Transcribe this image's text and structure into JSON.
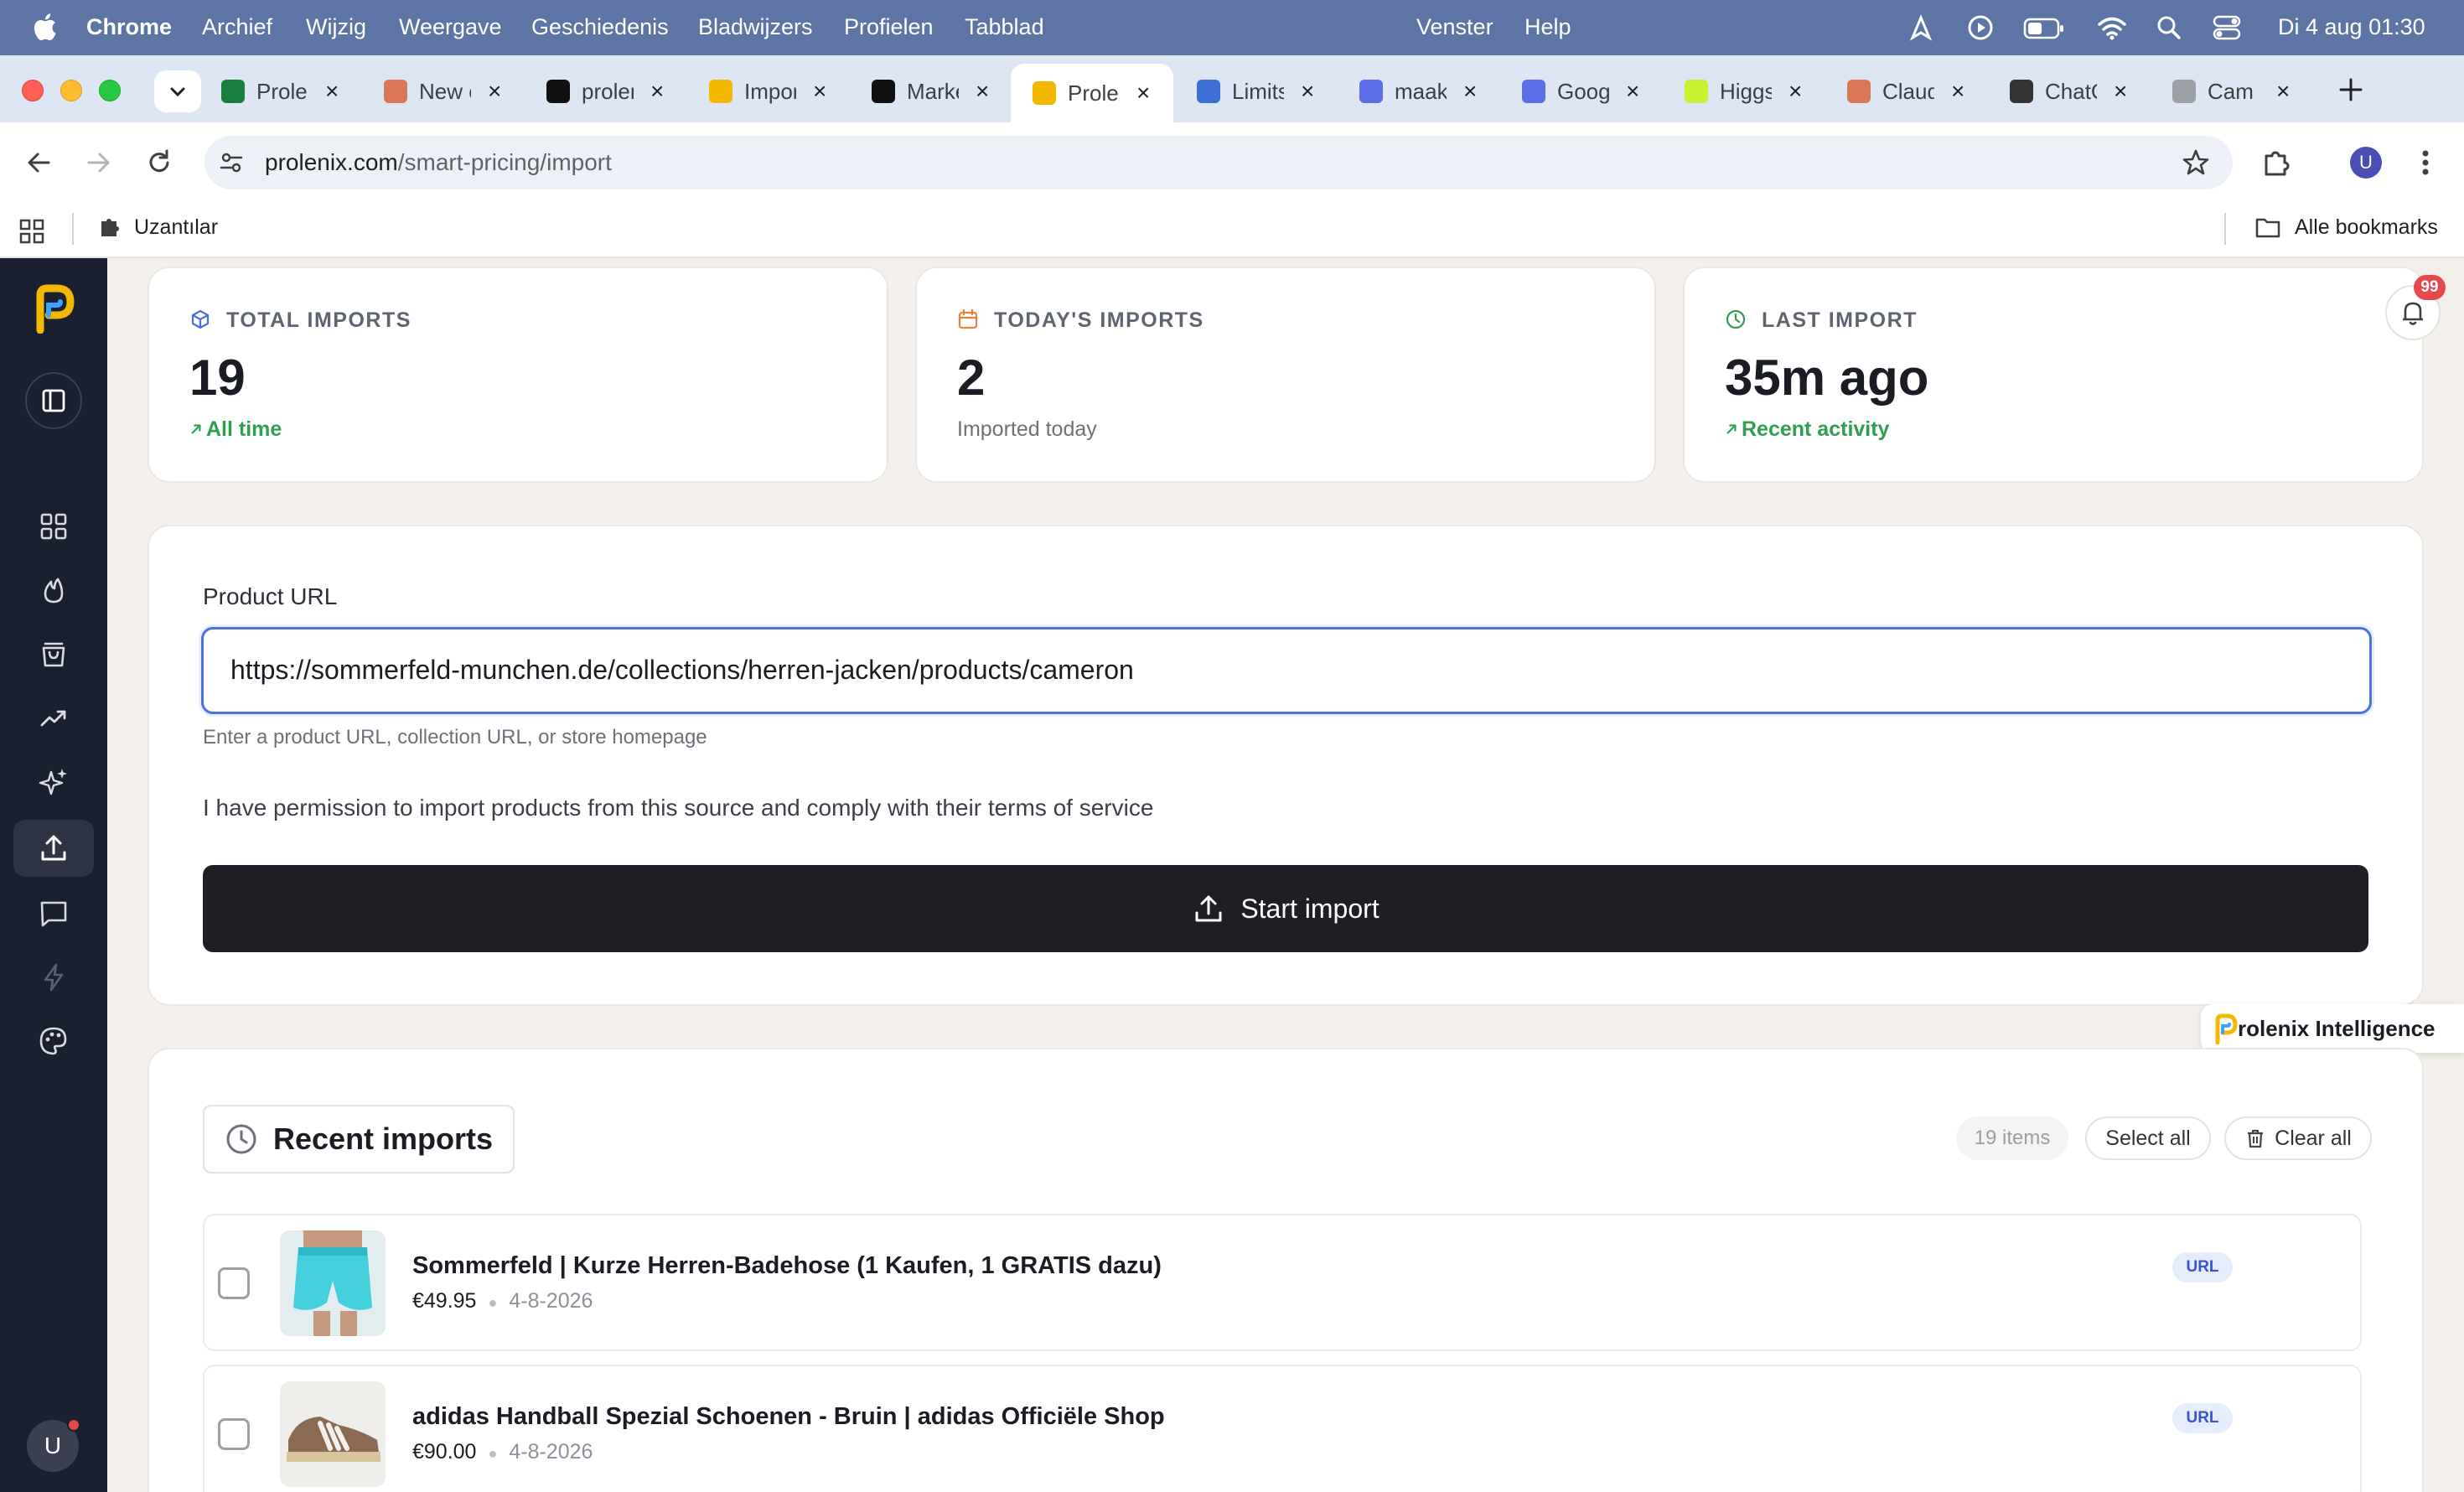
{
  "menubar": {
    "app": "Chrome",
    "items": [
      "Archief",
      "Wijzig",
      "Weergave",
      "Geschiedenis",
      "Bladwijzers",
      "Profielen",
      "Tabblad"
    ],
    "right_items": [
      "Venster",
      "Help"
    ],
    "clock": "Di 4 aug  01:30"
  },
  "tabs": [
    {
      "label": "Prolenix",
      "icon": "prolenix-bolt-icon",
      "color": "#1a7f3c"
    },
    {
      "label": "New chat",
      "icon": "claude-icon",
      "color": "#d97757"
    },
    {
      "label": "prolenix",
      "icon": "vercel-icon",
      "color": "#111111"
    },
    {
      "label": "Import",
      "icon": "prolenix-p-icon",
      "color": "#f5b800"
    },
    {
      "label": "Market",
      "icon": "p-logo-icon",
      "color": "#111111"
    },
    {
      "label": "Prolenix",
      "icon": "prolenix-p-icon",
      "color": "#f5b800"
    },
    {
      "label": "Limits",
      "icon": "openai-icon",
      "color": "#3b6fd6"
    },
    {
      "label": "maak",
      "icon": "gemini-icon",
      "color": "#5b6ee8"
    },
    {
      "label": "Google",
      "icon": "gemini-icon",
      "color": "#5b6ee8"
    },
    {
      "label": "Higgsfield",
      "icon": "higgsfield-icon",
      "color": "#c9f031"
    },
    {
      "label": "Claude",
      "icon": "claude-icon",
      "color": "#d97757"
    },
    {
      "label": "ChatGPT",
      "icon": "chatgpt-icon",
      "color": "#333333"
    },
    {
      "label": "Cam",
      "icon": "page-icon",
      "color": "#9aa0a6"
    }
  ],
  "address": {
    "domain": "prolenix.com",
    "path": "/smart-pricing/import"
  },
  "bookmarks": {
    "extensions_label": "Uzantılar",
    "all_bookmarks": "Alle bookmarks"
  },
  "profile_initial": "U",
  "notifications": {
    "count": "99"
  },
  "stats": [
    {
      "label": "TOTAL IMPORTS",
      "value": "19",
      "sub": "All time",
      "icon": "cube-icon",
      "icon_color": "#4a6fdc",
      "sub_trend": true
    },
    {
      "label": "TODAY'S IMPORTS",
      "value": "2",
      "sub": "Imported today",
      "icon": "calendar-icon",
      "icon_color": "#e8843a",
      "sub_trend": false
    },
    {
      "label": "LAST IMPORT",
      "value": "35m ago",
      "sub": "Recent activity",
      "icon": "clock-icon",
      "icon_color": "#2e9f4e",
      "sub_trend": true
    }
  ],
  "form": {
    "url_label": "Product URL",
    "url_value": "https://sommerfeld-munchen.de/collections/herren-jacken/products/cameron",
    "url_help": "Enter a product URL, collection URL, or store homepage",
    "permission_text": "I have permission to import products from this source and comply with their terms of service",
    "submit_label": "Start import"
  },
  "assistant": {
    "label": "rolenix Intelligence"
  },
  "recent": {
    "title": "Recent imports",
    "count": "19 items",
    "select_all": "Select all",
    "clear_all": "Clear all",
    "items": [
      {
        "title": "Sommerfeld | Kurze Herren-Badehose (1 Kaufen, 1 GRATIS dazu)",
        "price": "€49.95",
        "date": "4-8-2026",
        "source": "URL"
      },
      {
        "title": "adidas Handball Spezial Schoenen - Bruin | adidas Officiële Shop",
        "price": "€90.00",
        "date": "4-8-2026",
        "source": "URL"
      }
    ]
  }
}
